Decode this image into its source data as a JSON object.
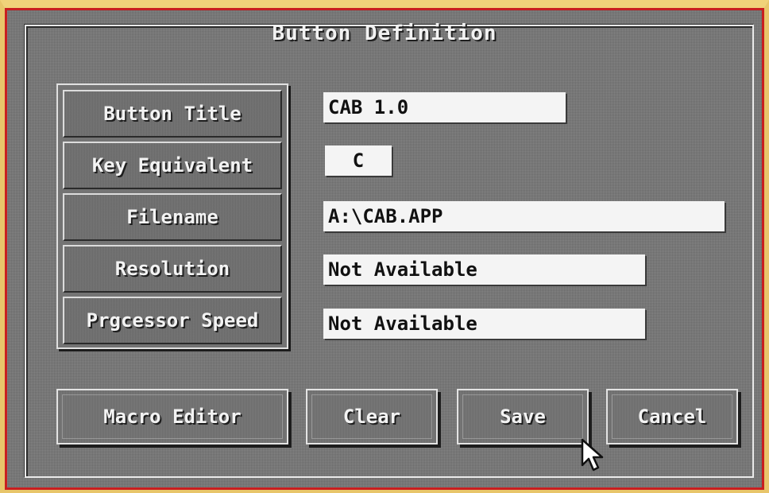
{
  "dialog": {
    "title": "Button Definition"
  },
  "labels": [
    {
      "text": "Button Title"
    },
    {
      "text": "Key Equivalent"
    },
    {
      "text": "Filename"
    },
    {
      "text": "Resolution"
    },
    {
      "text": "Prgcessor Speed"
    }
  ],
  "fields": {
    "button_title": "CAB 1.0",
    "key_equivalent": "C",
    "filename": "A:\\CAB.APP",
    "resolution": "Not Available",
    "processor_speed": "Not Available"
  },
  "buttons": {
    "macro_editor": "Macro Editor",
    "clear": "Clear",
    "save": "Save",
    "cancel": "Cancel"
  },
  "colors": {
    "background": "#767676",
    "frame_border": "#c81e20",
    "field_background": "#f4f4f4",
    "text_light": "#f3f3f3"
  },
  "icons": {
    "cursor": "mouse-pointer-icon"
  }
}
